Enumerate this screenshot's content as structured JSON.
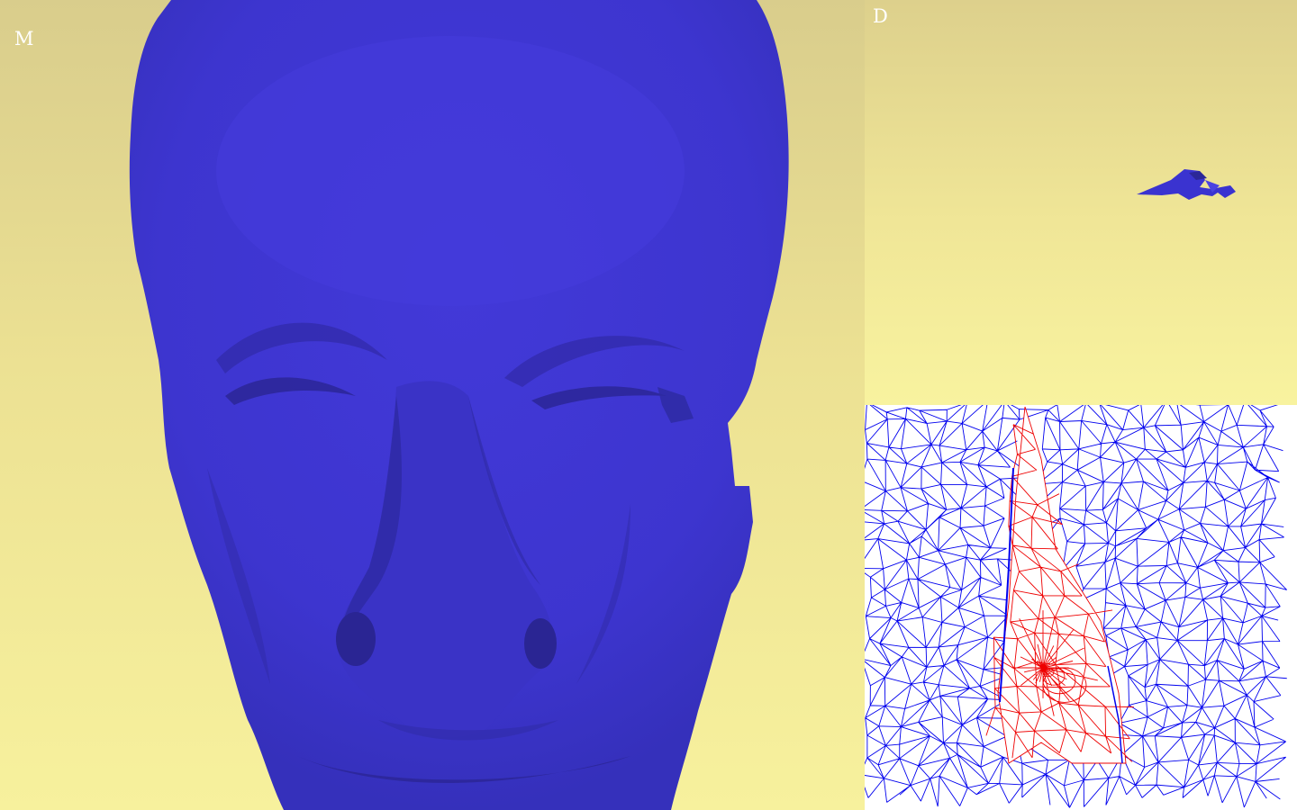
{
  "viewports": {
    "main": {
      "label": "M"
    },
    "detail": {
      "label": "D"
    },
    "parameter": {
      "label": ""
    }
  },
  "colors": {
    "background_top": "#d9cd8c",
    "background_bottom": "#f7f19d",
    "mesh_surface": "#3f37d4",
    "mesh_shadow": "#2f29a8",
    "wireframe_outer": "#0000ee",
    "wireframe_patch": "#ee0000",
    "label": "#ffffff"
  },
  "icons": {
    "main_model": "face-mesh-icon",
    "detail_model": "nose-patch-icon",
    "parameter_mesh": "wireframe-mesh-icon"
  }
}
